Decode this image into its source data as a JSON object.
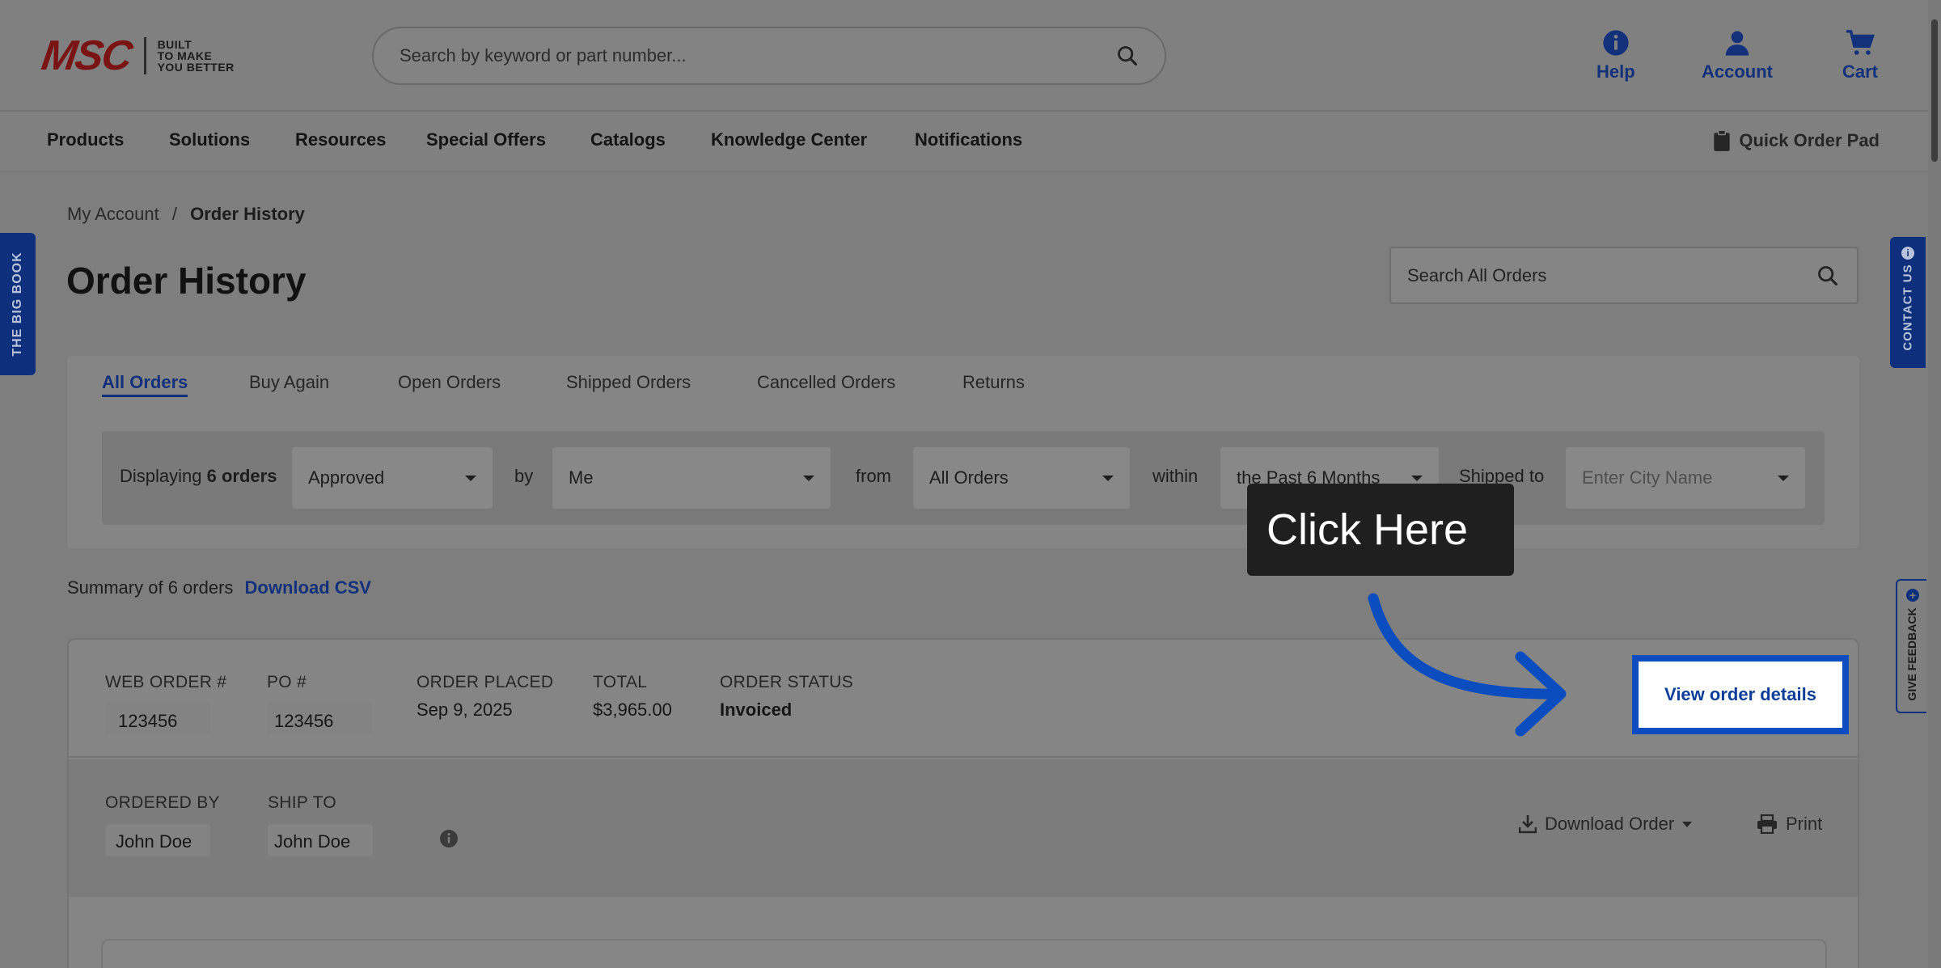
{
  "header": {
    "logo_mark": "MSC",
    "logo_tagline": [
      "BUILT",
      "TO MAKE",
      "YOU BETTER"
    ],
    "search_placeholder": "Search by keyword or part number...",
    "nav": {
      "help": "Help",
      "account": "Account",
      "cart": "Cart"
    }
  },
  "menu": {
    "items": [
      "Products",
      "Solutions",
      "Resources",
      "Special Offers",
      "Catalogs",
      "Knowledge Center",
      "Notifications"
    ],
    "quick_order": "Quick Order Pad"
  },
  "side_tabs": {
    "big_book": "THE BIG BOOK",
    "contact": "CONTACT US",
    "feedback": "GIVE FEEDBACK"
  },
  "breadcrumb": {
    "parent": "My Account",
    "separator": "/",
    "current": "Order History"
  },
  "page_title": "Order History",
  "order_search_placeholder": "Search All Orders",
  "tabs": [
    "All Orders",
    "Buy Again",
    "Open Orders",
    "Shipped Orders",
    "Cancelled Orders",
    "Returns"
  ],
  "filters": {
    "displaying_prefix": "Displaying",
    "displaying_count": "6 orders",
    "status": "Approved",
    "by_label": "by",
    "by_value": "Me",
    "from_label": "from",
    "from_value": "All Orders",
    "within_label": "within",
    "within_value": "the Past 6 Months",
    "shipped_to_label": "Shipped to",
    "shipped_to_placeholder": "Enter City Name"
  },
  "summary": {
    "text": "Summary of 6 orders",
    "download_csv": "Download CSV"
  },
  "order": {
    "web_order_label": "WEB ORDER #",
    "web_order_value": "123456",
    "po_label": "PO #",
    "po_value": "123456",
    "placed_label": "ORDER PLACED",
    "placed_value": "Sep 9, 2025",
    "total_label": "TOTAL",
    "total_value": "$3,965.00",
    "status_label": "ORDER STATUS",
    "status_value": "Invoiced",
    "ordered_by_label": "ORDERED BY",
    "ordered_by_value": "John Doe",
    "ship_to_label": "SHIP TO",
    "ship_to_value": "John Doe",
    "details_button": "View order details",
    "download_order": "Download Order",
    "print": "Print"
  },
  "callout": {
    "text": "Click Here",
    "highlight_color": "#0b4dbf"
  },
  "colors": {
    "brand_blue": "#13307a",
    "brand_red": "#7a1414"
  }
}
